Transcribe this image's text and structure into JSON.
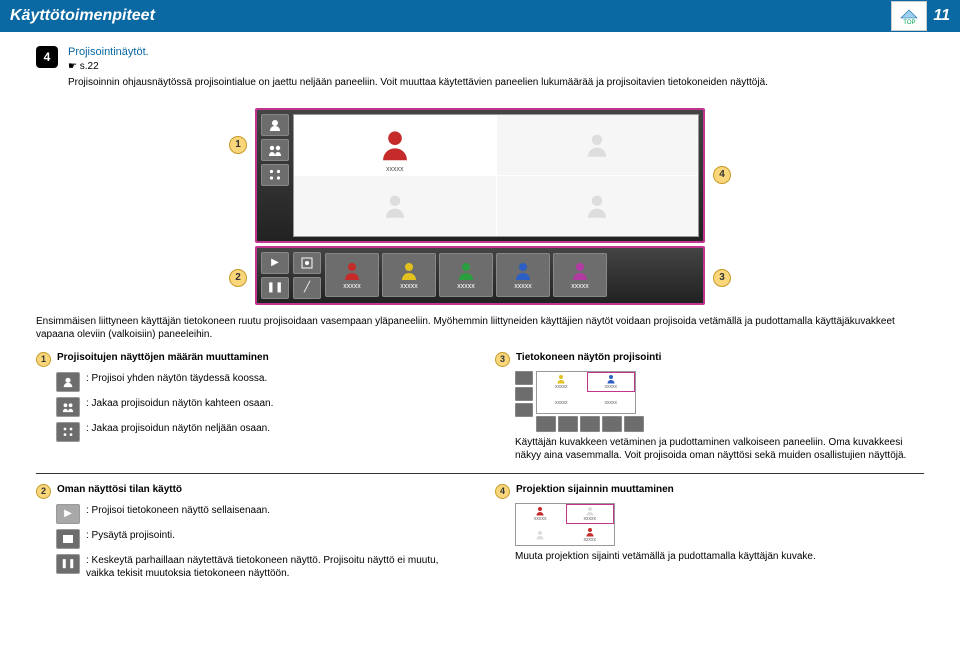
{
  "header": {
    "title": "Käyttötoimenpiteet",
    "logo": "TOP",
    "page": "11"
  },
  "step": {
    "num": "4",
    "title": "Projisointinäytöt.",
    "link": "☛ s.22",
    "para": "Projisoinnin ohjausnäytössä projisointialue on jaettu neljään paneeliin. Voit muuttaa käytettävien paneelien lukumäärää ja projisoitavien tietokoneiden näyttöjä."
  },
  "diagram": {
    "placeholder": "xxxxx"
  },
  "below": "Ensimmäisen liittyneen käyttäjän tietokoneen ruutu projisoidaan vasempaan yläpaneeliin. Myöhemmin liittyneiden käyttäjien näytöt voidaan projisoida vetämällä ja pudottamalla käyttäjäkuvakkeet vapaana oleviin (valkoisiin) paneeleihin.",
  "sec1": {
    "title": "Projisoitujen näyttöjen määrän muuttaminen",
    "i1": ": Projisoi yhden näytön täydessä koossa.",
    "i2": ": Jakaa projisoidun näytön kahteen osaan.",
    "i3": ": Jakaa projisoidun näytön neljään osaan."
  },
  "sec2": {
    "title": "Oman näyttösi tilan käyttö",
    "i1": ": Projisoi tietokoneen näyttö sellaisenaan.",
    "i2": ": Pysäytä projisointi.",
    "i3": ": Keskeytä parhaillaan näytettävä tietokoneen näyttö. Projisoitu näyttö ei muutu, vaikka tekisit muutoksia tietokoneen näyttöön."
  },
  "sec3": {
    "title": "Tietokoneen näytön projisointi",
    "desc": "Käyttäjän kuvakkeen vetäminen ja pudottaminen valkoiseen paneeliin. Oma kuvakkeesi näkyy aina vasemmalla. Voit projisoida oman näyttösi sekä muiden osallistujien näyttöjä."
  },
  "sec4": {
    "title": "Projektion sijainnin muuttaminen",
    "desc": "Muuta projektion sijainti vetämällä ja pudottamalla käyttäjän kuvake."
  }
}
